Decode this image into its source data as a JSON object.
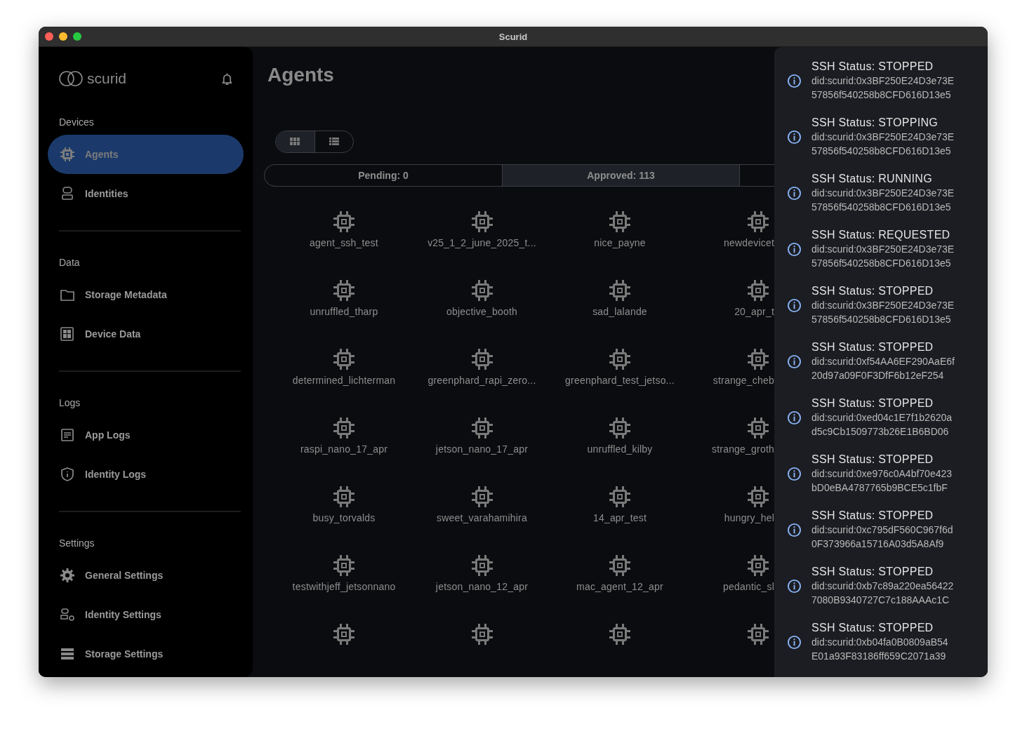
{
  "window": {
    "title": "Scurid"
  },
  "sidebar": {
    "logo": "scurid",
    "sections": [
      {
        "title": "Devices",
        "items": [
          {
            "label": "Agents",
            "kind": "chip",
            "selected": true
          },
          {
            "label": "Identities",
            "kind": "identity",
            "selected": false
          }
        ]
      },
      {
        "title": "Data",
        "items": [
          {
            "label": "Storage Metadata",
            "kind": "folder",
            "selected": false
          },
          {
            "label": "Device Data",
            "kind": "grid",
            "selected": false
          }
        ]
      },
      {
        "title": "Logs",
        "items": [
          {
            "label": "App Logs",
            "kind": "document",
            "selected": false
          },
          {
            "label": "Identity Logs",
            "kind": "shield",
            "selected": false
          }
        ]
      },
      {
        "title": "Settings",
        "items": [
          {
            "label": "General Settings",
            "kind": "gear",
            "selected": false
          },
          {
            "label": "Identity Settings",
            "kind": "identitygear",
            "selected": false
          },
          {
            "label": "Storage Settings",
            "kind": "storage",
            "selected": false
          }
        ]
      }
    ]
  },
  "page": {
    "title": "Agents",
    "view_toggle": [
      {
        "kind": "grid",
        "selected": true
      },
      {
        "kind": "list",
        "selected": false
      }
    ],
    "tabs": [
      {
        "label": "Pending: 0",
        "selected": false
      },
      {
        "label": "Approved: 113",
        "selected": true
      }
    ],
    "agents": [
      {
        "label": "agent_ssh_test"
      },
      {
        "label": "v25_1_2_june_2025_t..."
      },
      {
        "label": "nice_payne"
      },
      {
        "label": "newdevicet"
      },
      {
        "label": "unruffled_tharp"
      },
      {
        "label": "objective_booth"
      },
      {
        "label": "sad_lalande"
      },
      {
        "label": "20_apr_t"
      },
      {
        "label": "determined_lichterman"
      },
      {
        "label": "greenphard_rapi_zero..."
      },
      {
        "label": "greenphard_test_jetso..."
      },
      {
        "label": "strange_cheb"
      },
      {
        "label": "raspi_nano_17_apr"
      },
      {
        "label": "jetson_nano_17_apr"
      },
      {
        "label": "unruffled_kilby"
      },
      {
        "label": "strange_groth"
      },
      {
        "label": "busy_torvalds"
      },
      {
        "label": "sweet_varahamihira"
      },
      {
        "label": "14_apr_test"
      },
      {
        "label": "hungry_hel"
      },
      {
        "label": "testwithjeff_jetsonnano"
      },
      {
        "label": "jetson_nano_12_apr"
      },
      {
        "label": "mac_agent_12_apr"
      },
      {
        "label": "pedantic_sl"
      },
      {
        "kind": "unnamed"
      },
      {
        "kind": "unnamed"
      },
      {
        "kind": "unnamed"
      },
      {
        "kind": "unnamed"
      }
    ]
  },
  "notifications": [
    {
      "status": "SSH Status: STOPPED",
      "did_lines": [
        "did:scurid:0x3BF250E24D3e73E",
        "57856f540258b8CFD616D13e5"
      ]
    },
    {
      "status": "SSH Status: STOPPING",
      "did_lines": [
        "did:scurid:0x3BF250E24D3e73E",
        "57856f540258b8CFD616D13e5"
      ]
    },
    {
      "status": "SSH Status: RUNNING",
      "did_lines": [
        "did:scurid:0x3BF250E24D3e73E",
        "57856f540258b8CFD616D13e5"
      ]
    },
    {
      "status": "SSH Status: REQUESTED",
      "did_lines": [
        "did:scurid:0x3BF250E24D3e73E",
        "57856f540258b8CFD616D13e5"
      ]
    },
    {
      "status": "SSH Status: STOPPED",
      "did_lines": [
        "did:scurid:0x3BF250E24D3e73E",
        "57856f540258b8CFD616D13e5"
      ]
    },
    {
      "status": "SSH Status: STOPPED",
      "did_lines": [
        "did:scurid:0xf54AA6EF290AaE6f",
        "20d97a09F0F3DfF6b12eF254"
      ]
    },
    {
      "status": "SSH Status: STOPPED",
      "did_lines": [
        "did:scurid:0xed04c1E7f1b2620a",
        "d5c9Cb1509773b26E1B6BD06"
      ]
    },
    {
      "status": "SSH Status: STOPPED",
      "did_lines": [
        "did:scurid:0xe976c0A4bf70e423",
        "bD0eBA4787765b9BCE5c1fbF"
      ]
    },
    {
      "status": "SSH Status: STOPPED",
      "did_lines": [
        "did:scurid:0xc795dF560C967f6d",
        "0F373966a15716A03d5A8Af9"
      ]
    },
    {
      "status": "SSH Status: STOPPED",
      "did_lines": [
        "did:scurid:0xb7c89a220ea56422",
        "7080B9340727C7c188AAAc1C"
      ]
    },
    {
      "status": "SSH Status: STOPPED",
      "did_lines": [
        "did:scurid:0xb04fa0B0809aB54",
        "E01a93F83186ff659C2071a39"
      ]
    }
  ]
}
